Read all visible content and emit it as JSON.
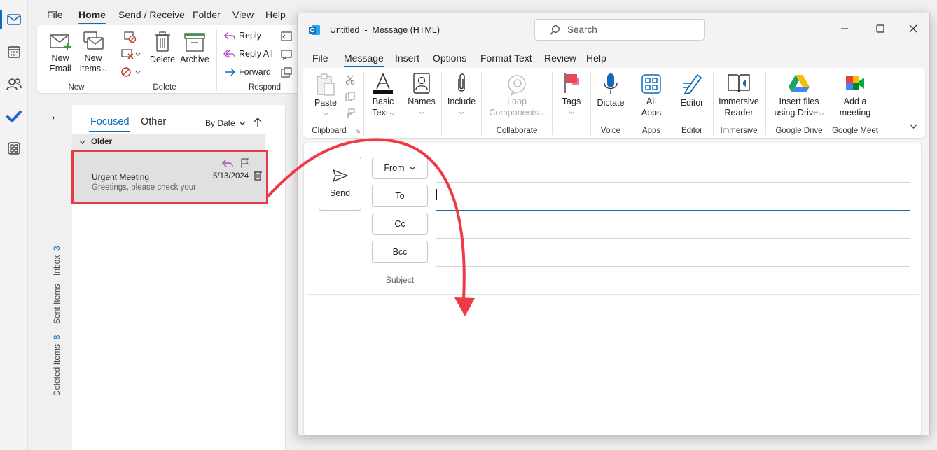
{
  "rail": {
    "icons": [
      "mail-icon",
      "calendar-icon",
      "people-icon",
      "todo-icon",
      "apps-icon"
    ]
  },
  "main_tabs": [
    "File",
    "Home",
    "Send / Receive",
    "Folder",
    "View",
    "Help"
  ],
  "main_ribbon": {
    "new_email": [
      "New",
      "Email"
    ],
    "new_items": [
      "New",
      "Items"
    ],
    "group_new": "New",
    "delete": "Delete",
    "archive": "Archive",
    "group_delete": "Delete",
    "reply": "Reply",
    "reply_all": "Reply All",
    "forward": "Forward",
    "group_respond": "Respond"
  },
  "folders": {
    "inbox": "Inbox",
    "inbox_count": "3",
    "sent": "Sent Items",
    "deleted": "Deleted Items",
    "deleted_count": "8"
  },
  "list": {
    "tab_focused": "Focused",
    "tab_other": "Other",
    "sort": "By Date",
    "group": "Older",
    "item": {
      "subject": "Urgent Meeting",
      "preview": "Greetings, please check your",
      "date": "5/13/2024"
    }
  },
  "compose": {
    "title": "Untitled  -  Message (HTML)",
    "search_placeholder": "Search",
    "tabs": [
      "File",
      "Message",
      "Insert",
      "Options",
      "Format Text",
      "Review",
      "Help"
    ],
    "ribbon": {
      "paste": "Paste",
      "basic_text": [
        "Basic",
        "Text"
      ],
      "names": "Names",
      "include": "Include",
      "loop": [
        "Loop",
        "Components"
      ],
      "tags": "Tags",
      "dictate": "Dictate",
      "all_apps": [
        "All",
        "Apps"
      ],
      "editor": "Editor",
      "immersive_reader": [
        "Immersive",
        "Reader"
      ],
      "insert_drive": [
        "Insert files",
        "using Drive"
      ],
      "add_meeting": [
        "Add a",
        "meeting"
      ],
      "groups": {
        "clipboard": "Clipboard",
        "collaborate": "Collaborate",
        "voice": "Voice",
        "apps": "Apps",
        "editor": "Editor",
        "immersive": "Immersive",
        "google_drive": "Google Drive",
        "google_meet": "Google Meet"
      }
    },
    "send": "Send",
    "from": "From",
    "to": "To",
    "cc": "Cc",
    "bcc": "Bcc",
    "subject": "Subject"
  },
  "colors": {
    "accent": "#0f6cbd",
    "highlight": "#e53945",
    "reply_icon": "#b146c2"
  }
}
